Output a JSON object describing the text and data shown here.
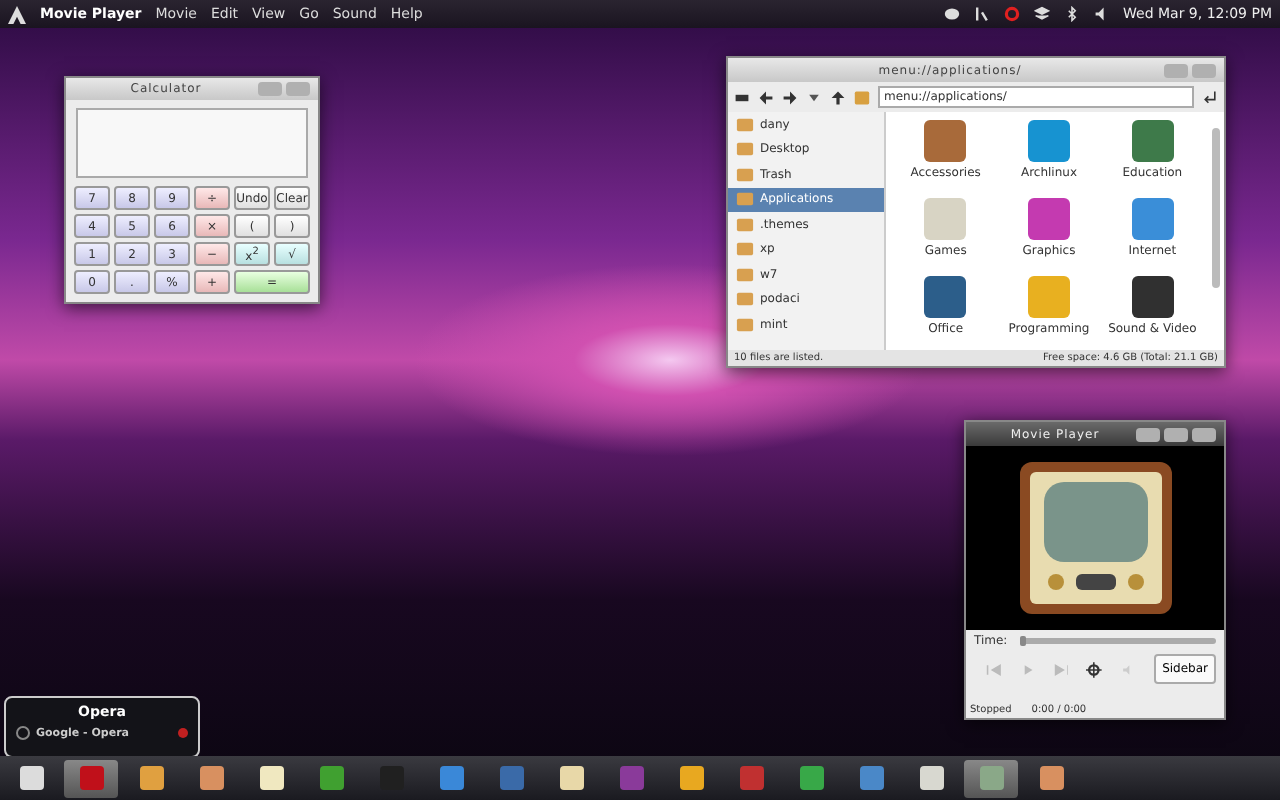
{
  "top_bar": {
    "app_name": "Movie Player",
    "menus": [
      "Movie",
      "Edit",
      "View",
      "Go",
      "Sound",
      "Help"
    ],
    "clock": "Wed Mar 9, 12:09 PM"
  },
  "calculator": {
    "title": "Calculator",
    "keys": [
      {
        "label": "7",
        "kind": "digit"
      },
      {
        "label": "8",
        "kind": "digit"
      },
      {
        "label": "9",
        "kind": "digit"
      },
      {
        "label": "÷",
        "kind": "op"
      },
      {
        "label": "Undo",
        "kind": "func"
      },
      {
        "label": "Clear",
        "kind": "func"
      },
      {
        "label": "4",
        "kind": "digit"
      },
      {
        "label": "5",
        "kind": "digit"
      },
      {
        "label": "6",
        "kind": "digit"
      },
      {
        "label": "×",
        "kind": "op"
      },
      {
        "label": "(",
        "kind": "func"
      },
      {
        "label": ")",
        "kind": "func"
      },
      {
        "label": "1",
        "kind": "digit"
      },
      {
        "label": "2",
        "kind": "digit"
      },
      {
        "label": "3",
        "kind": "digit"
      },
      {
        "label": "−",
        "kind": "op"
      },
      {
        "label": "x$^{2}$",
        "kind": "sci"
      },
      {
        "label": "√",
        "kind": "sci"
      },
      {
        "label": "0",
        "kind": "digit"
      },
      {
        "label": ".",
        "kind": "digit"
      },
      {
        "label": "%",
        "kind": "digit"
      },
      {
        "label": "+",
        "kind": "op"
      },
      {
        "label": "=",
        "kind": "equals"
      }
    ]
  },
  "file_manager": {
    "title": "menu://applications/",
    "location": "menu://applications/",
    "places": [
      {
        "label": "dany",
        "selected": false
      },
      {
        "label": "Desktop",
        "selected": false
      },
      {
        "label": "Trash",
        "selected": false
      },
      {
        "label": "Applications",
        "selected": true
      },
      {
        "label": ".themes",
        "selected": false
      },
      {
        "label": "xp",
        "selected": false
      },
      {
        "label": "w7",
        "selected": false
      },
      {
        "label": "podaci",
        "selected": false
      },
      {
        "label": "mint",
        "selected": false
      }
    ],
    "items": [
      {
        "label": "Accessories",
        "color": "#a86a3a"
      },
      {
        "label": "Archlinux",
        "color": "#1793d1"
      },
      {
        "label": "Education",
        "color": "#3e7a4a"
      },
      {
        "label": "Games",
        "color": "#d8d4c4"
      },
      {
        "label": "Graphics",
        "color": "#c43ab0"
      },
      {
        "label": "Internet",
        "color": "#3a8ed8"
      },
      {
        "label": "Office",
        "color": "#2c5e8a"
      },
      {
        "label": "Programming",
        "color": "#e8b020"
      },
      {
        "label": "Sound & Video",
        "color": "#303030"
      }
    ],
    "status": "10 files are listed.",
    "free_space": "Free space: 4.6 GB (Total: 21.1 GB)"
  },
  "movie_player": {
    "title": "Movie Player",
    "time_label": "Time:",
    "level": 0,
    "sidebar_button": "Sidebar",
    "state": "Stopped",
    "time": "0:00 / 0:00"
  },
  "tooltip": {
    "title": "Opera",
    "item": "Google - Opera"
  },
  "dock": [
    {
      "color": "#dcdcdc",
      "selected": false
    },
    {
      "color": "#c0101a",
      "selected": true
    },
    {
      "color": "#e0a040",
      "selected": false
    },
    {
      "color": "#d89060",
      "selected": false
    },
    {
      "color": "#f0e8c0",
      "selected": false
    },
    {
      "color": "#40a030",
      "selected": false
    },
    {
      "color": "#202020",
      "selected": false
    },
    {
      "color": "#3a88d8",
      "selected": false
    },
    {
      "color": "#3a6aa8",
      "selected": false
    },
    {
      "color": "#e8d8a8",
      "selected": false
    },
    {
      "color": "#8a3a9a",
      "selected": false
    },
    {
      "color": "#e8a820",
      "selected": false
    },
    {
      "color": "#c03030",
      "selected": false
    },
    {
      "color": "#38a848",
      "selected": false
    },
    {
      "color": "#4a88c8",
      "selected": false
    },
    {
      "color": "#d8d8d0",
      "selected": false
    },
    {
      "color": "#8aa888",
      "selected": true
    },
    {
      "color": "#d89060",
      "selected": false
    }
  ]
}
